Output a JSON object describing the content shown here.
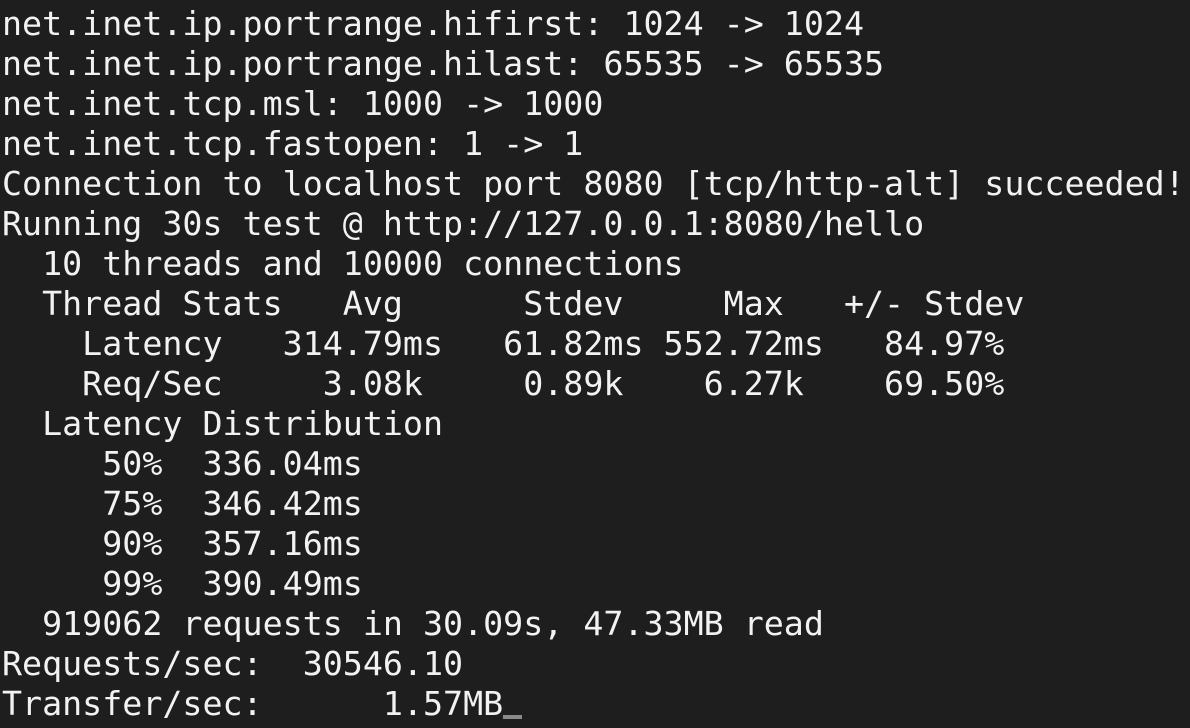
{
  "theme": {
    "background": "#1e1e1e",
    "foreground": "#f2f2f2",
    "cursor_color": "#8a8a8a"
  },
  "terminal": {
    "lines": [
      "net.inet.ip.portrange.hifirst: 1024 -> 1024",
      "net.inet.ip.portrange.hilast: 65535 -> 65535",
      "net.inet.tcp.msl: 1000 -> 1000",
      "net.inet.tcp.fastopen: 1 -> 1",
      "Connection to localhost port 8080 [tcp/http-alt] succeeded!",
      "Running 30s test @ http://127.0.0.1:8080/hello",
      "  10 threads and 10000 connections",
      "  Thread Stats   Avg      Stdev     Max   +/- Stdev",
      "    Latency   314.79ms   61.82ms 552.72ms   84.97%",
      "    Req/Sec     3.08k     0.89k    6.27k    69.50%",
      "  Latency Distribution",
      "     50%  336.04ms",
      "     75%  346.42ms",
      "     90%  357.16ms",
      "     99%  390.49ms",
      "  919062 requests in 30.09s, 47.33MB read",
      "Requests/sec:  30546.10",
      "Transfer/sec:      1.57MB"
    ]
  }
}
